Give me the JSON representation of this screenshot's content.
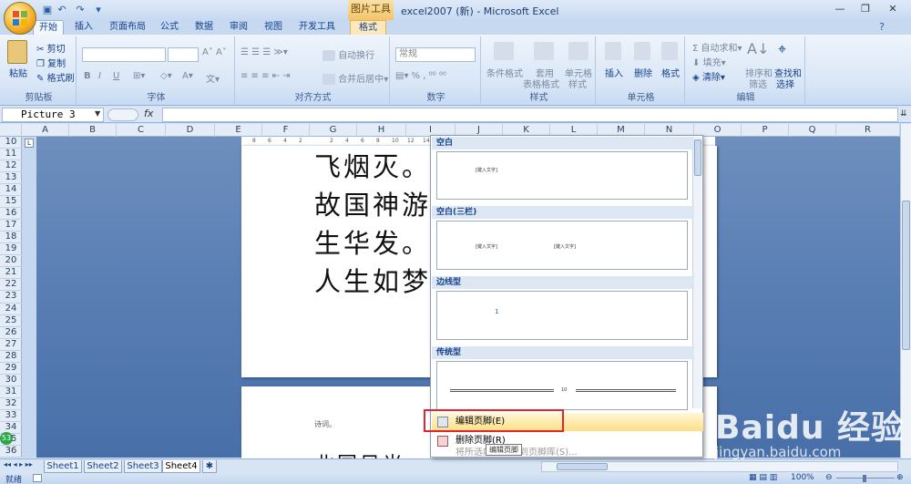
{
  "window": {
    "context_tool": "图片工具",
    "title": "excel2007 (新) - Microsoft Excel"
  },
  "tabs": [
    "开始",
    "插入",
    "页面布局",
    "公式",
    "数据",
    "审阅",
    "视图",
    "开发工具",
    "格式"
  ],
  "ribbon": {
    "clipboard": {
      "paste": "粘贴",
      "cut": "剪切",
      "copy": "复制",
      "format_painter": "格式刷",
      "label": "剪贴板"
    },
    "font": {
      "label": "字体"
    },
    "alignment": {
      "wrap": "自动换行",
      "merge": "合并后居中",
      "label": "对齐方式"
    },
    "number": {
      "format": "常规",
      "label": "数字"
    },
    "styles": {
      "conditional": "条件格式",
      "table": "套用\n表格格式",
      "cell_styles": "单元格\n样式",
      "label": "样式",
      "table_l1": "套用",
      "table_l2": "表格格式",
      "cell_l1": "单元格",
      "cell_l2": "样式"
    },
    "cells": {
      "insert": "插入",
      "delete": "删除",
      "format": "格式",
      "label": "单元格"
    },
    "editing": {
      "autosum": "自动求和",
      "fill": "填充",
      "clear": "清除",
      "sort_l1": "排序和",
      "sort_l2": "筛选",
      "find_l1": "查找和",
      "find_l2": "选择",
      "label": "编辑"
    }
  },
  "formula_bar": {
    "name_box": "Picture 3",
    "fx": "fx"
  },
  "columns": [
    "A",
    "B",
    "C",
    "D",
    "E",
    "F",
    "G",
    "H",
    "I",
    "J",
    "K",
    "L",
    "M",
    "N",
    "O",
    "P",
    "Q",
    "R"
  ],
  "rows": [
    "10",
    "11",
    "12",
    "13",
    "14",
    "15",
    "16",
    "17",
    "18",
    "19",
    "20",
    "21",
    "22",
    "23",
    "24",
    "25",
    "26",
    "27",
    "28",
    "29",
    "30",
    "31",
    "32",
    "33",
    "34",
    "35",
    "36"
  ],
  "ruler_numbers": [
    "8",
    "6",
    "4",
    "2",
    "",
    "2",
    "4",
    "6",
    "8",
    "10",
    "12",
    "14"
  ],
  "document": {
    "lines": [
      "飞烟灭。",
      "故国神游",
      "生华发。",
      "人生如梦"
    ],
    "page2_caption": "诗词。",
    "page2_line": "北国风光"
  },
  "gallery": {
    "sections": [
      {
        "title": "空白",
        "placeholders": [
          "[键入文字]"
        ]
      },
      {
        "title": "空白(三栏)",
        "placeholders": [
          "[键入文字]",
          "[键入文字]",
          "[键入文字]"
        ]
      },
      {
        "title": "边线型",
        "placeholders": [
          "1"
        ]
      },
      {
        "title": "传统型",
        "placeholders": [
          "10"
        ]
      }
    ],
    "menu": {
      "edit_footer": "编辑页脚(E)",
      "remove_footer": "删除页脚(R)",
      "save_selection": "将所选内容保存到页脚库(S)..."
    },
    "tooltip": "编辑页脚"
  },
  "sheets": [
    "Sheet1",
    "Sheet2",
    "Sheet3",
    "Sheet4"
  ],
  "status": {
    "ready": "就绪",
    "zoom": "100%",
    "badge": "53"
  },
  "watermark": {
    "brand": "Baidu 经验",
    "url": "jingyan.baidu.com"
  }
}
